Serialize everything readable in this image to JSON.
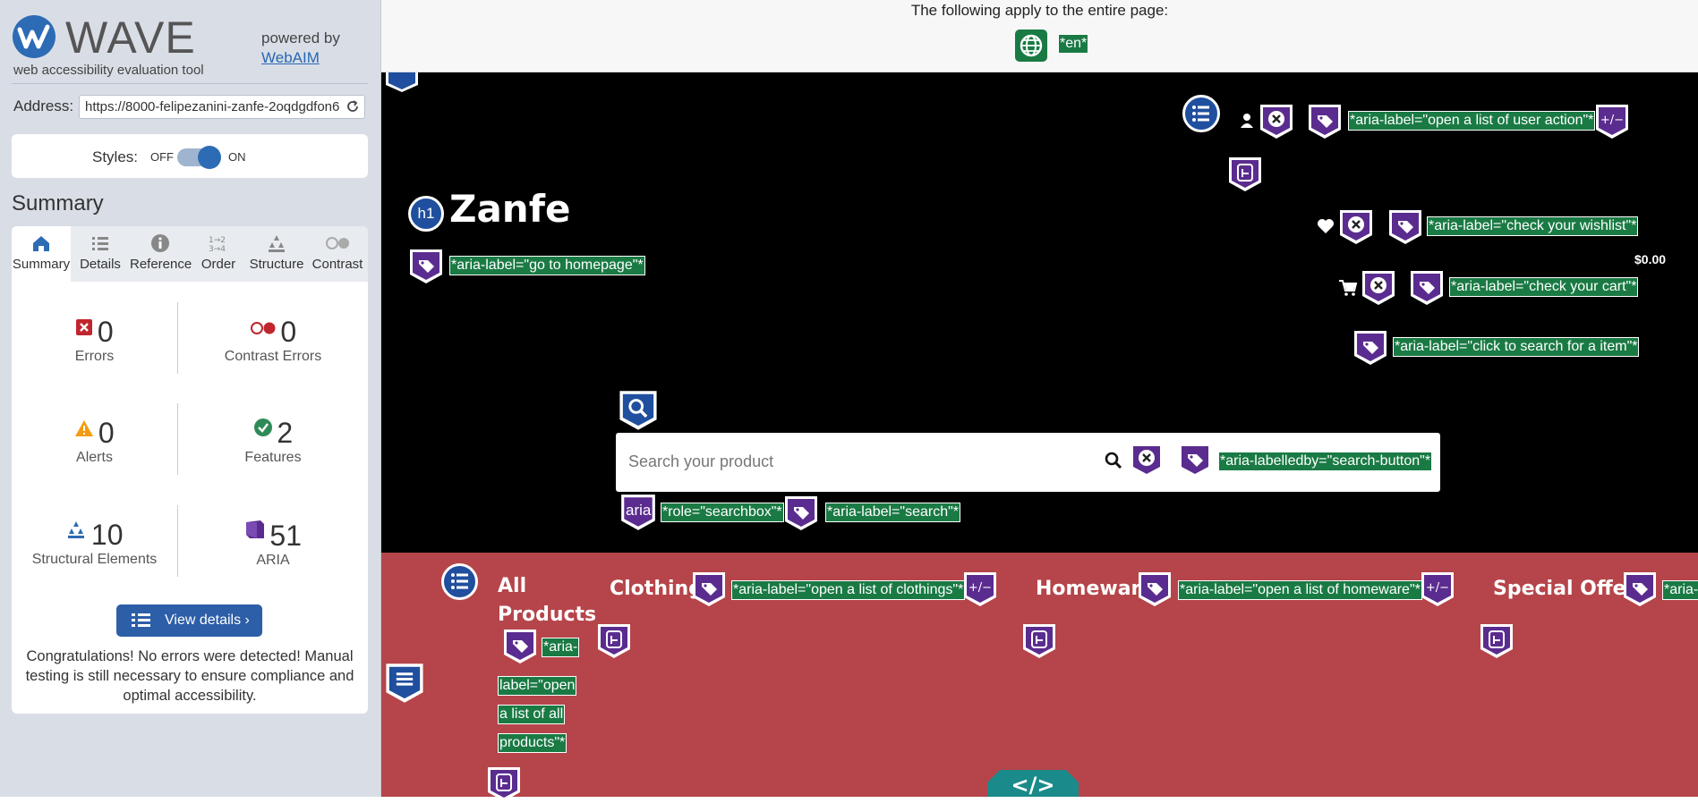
{
  "panel": {
    "logo": "WAVE",
    "subtitle": "web accessibility evaluation tool",
    "powered_by": "powered by",
    "webaim": "WebAIM",
    "address_label": "Address:",
    "address_value": "https://8000-felipezanini-zanfe-2oqdgdfon6",
    "styles_label": "Styles:",
    "styles_off": "OFF",
    "styles_on": "ON",
    "summary_heading": "Summary",
    "tabs": [
      "Summary",
      "Details",
      "Reference",
      "Order",
      "Structure",
      "Contrast"
    ],
    "stats": {
      "errors": {
        "value": "0",
        "label": "Errors"
      },
      "contrast": {
        "value": "0",
        "label": "Contrast Errors"
      },
      "alerts": {
        "value": "0",
        "label": "Alerts"
      },
      "features": {
        "value": "2",
        "label": "Features"
      },
      "structural": {
        "value": "10",
        "label": "Structural Elements"
      },
      "aria": {
        "value": "51",
        "label": "ARIA"
      }
    },
    "view_details": "View details ›",
    "congrats": "Congratulations! No errors were detected! Manual testing is still necessary to ensure compliance and optimal accessibility."
  },
  "page": {
    "topbar_text": "The following apply to the entire page:",
    "lang_label": "*en*",
    "brand": "Zanfe",
    "h1_badge": "h1",
    "aria_go_home": "*aria-label=\"go to homepage\"*",
    "aria_user_actions": "*aria-label=\"open a list of user action\"*",
    "aria_wishlist": "*aria-label=\"check your wishlist\"*",
    "cart_total": "$0.00",
    "aria_cart": "*aria-label=\"check your cart\"*",
    "aria_search_item": "*aria-label=\"click to search for a item\"*",
    "search_placeholder": "Search your product",
    "aria_labelledby": "*aria-labelledby=\"search-button\"*",
    "aria_badge": "aria",
    "role_searchbox": "*role=\"searchbox\"*",
    "aria_search": "*aria-label=\"search\"*",
    "plusminus": "+/−",
    "nav": {
      "all_products_1": "All",
      "all_products_2": "Products",
      "all_products_aria": [
        "*aria-",
        "label=\"open",
        "a list of all",
        "products\"*"
      ],
      "clothing": "Clothing",
      "aria_clothing": "*aria-label=\"open a list of clothings\"*",
      "homeware": "Homeware",
      "aria_homeware": "*aria-label=\"open a list of homeware\"*",
      "special_offers": "Special Offers",
      "aria_special": "*aria-la"
    }
  },
  "colors": {
    "aria_green": "#1a7a44",
    "aria_purple": "#5b2c8f",
    "nav_red": "#b5454a",
    "wave_blue": "#2d5ea8"
  }
}
